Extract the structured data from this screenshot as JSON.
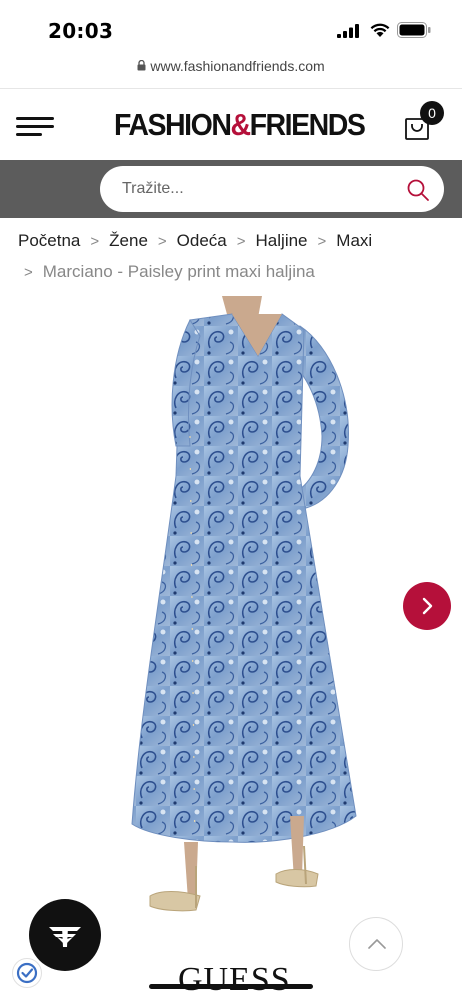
{
  "status": {
    "time": "20:03"
  },
  "browser": {
    "url": "www.fashionandfriends.com"
  },
  "header": {
    "logo_left": "FASHION",
    "logo_amp": "&",
    "logo_right": "FRIENDS",
    "cart_count": "0",
    "brand_color": "#b5103a"
  },
  "search": {
    "placeholder": "Tražite..."
  },
  "breadcrumb": {
    "items": [
      "Početna",
      "Žene",
      "Odeća",
      "Haljine",
      "Maxi"
    ],
    "current": "Marciano - Paisley print maxi haljina"
  },
  "product": {
    "brand": "GUESS"
  },
  "icons": [
    "menu-icon",
    "cart-icon",
    "search-icon",
    "chevron-right-icon",
    "chevron-up-icon",
    "ff-logo-icon",
    "verified-check-icon",
    "lock-icon"
  ]
}
